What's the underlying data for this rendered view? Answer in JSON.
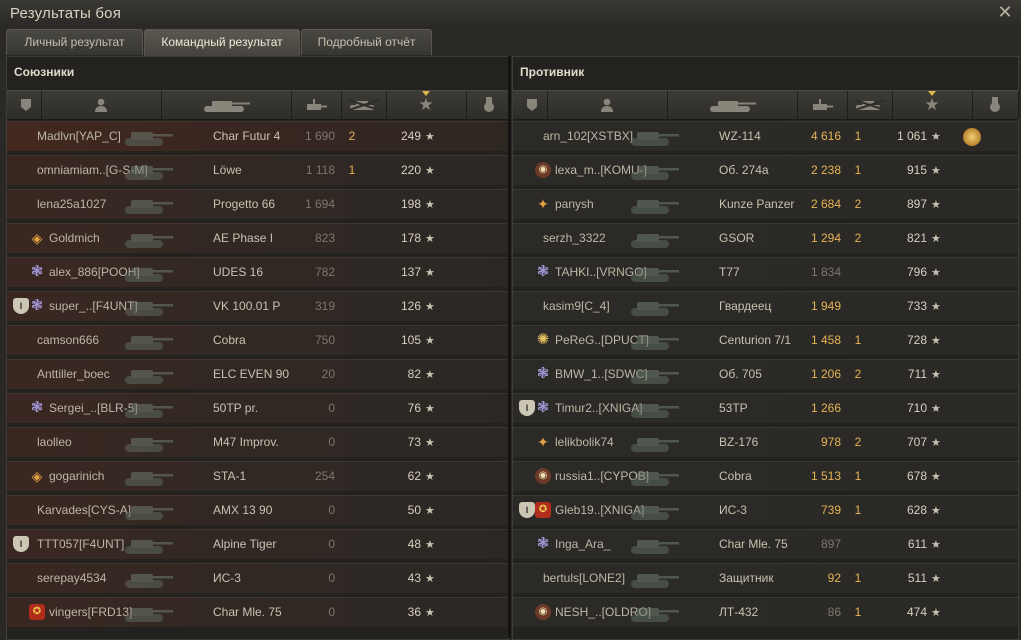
{
  "window": {
    "title": "Результаты боя",
    "close_icon": "close-icon"
  },
  "tabs": [
    {
      "label": "Личный результат",
      "active": false
    },
    {
      "label": "Командный результат",
      "active": true
    },
    {
      "label": "Подробный отчёт",
      "active": false
    }
  ],
  "columns": [
    "squad-icon",
    "player-icon",
    "tank-icon",
    "damage-icon",
    "kills-icon",
    "xp-star-icon",
    "medal-icon"
  ],
  "allies": {
    "title": "Союзники",
    "rows": [
      {
        "name": "Madlvn[YAP_C]",
        "badge": "",
        "tank": "Char Futur 4",
        "damage": "1 690",
        "kills": "2",
        "xp": "249",
        "highlight": true
      },
      {
        "name": "omniamiam..[G-S-M]",
        "badge": "",
        "tank": "Löwe",
        "damage": "1 118",
        "kills": "1",
        "xp": "220"
      },
      {
        "name": "lena25a1027",
        "badge": "",
        "tank": "Progetto 66",
        "damage": "1 694",
        "kills": "",
        "xp": "198"
      },
      {
        "name": "Goldmich",
        "badge": "diamond",
        "tank": "AE Phase I",
        "damage": "823",
        "kills": "",
        "xp": "178"
      },
      {
        "name": "alex_886[POOH]",
        "badge": "gear",
        "tank": "UDES 16",
        "damage": "782",
        "kills": "",
        "xp": "137"
      },
      {
        "name": "super_..[F4UNT]",
        "badge": "gear",
        "squad": "I",
        "tank": "VK 100.01 P",
        "damage": "319",
        "kills": "",
        "xp": "126"
      },
      {
        "name": "camson666",
        "badge": "",
        "tank": "Cobra",
        "damage": "750",
        "kills": "",
        "xp": "105"
      },
      {
        "name": "Anttiller_boec",
        "badge": "",
        "tank": "ELC EVEN 90",
        "damage": "20",
        "kills": "",
        "xp": "82"
      },
      {
        "name": "Sergei_..[BLR-5]",
        "badge": "gear",
        "tank": "50TP pr.",
        "damage": "0",
        "kills": "",
        "xp": "76"
      },
      {
        "name": "laolleo",
        "badge": "",
        "tank": "M47 Improv.",
        "damage": "0",
        "kills": "",
        "xp": "73"
      },
      {
        "name": "gogarinich",
        "badge": "diamond",
        "tank": "STA-1",
        "damage": "254",
        "kills": "",
        "xp": "62"
      },
      {
        "name": "Karvades[CYS-A]",
        "badge": "",
        "tank": "AMX 13 90",
        "damage": "0",
        "kills": "",
        "xp": "50"
      },
      {
        "name": "TTT057[F4UNT]",
        "badge": "",
        "squad": "I",
        "tank": "Alpine Tiger",
        "damage": "0",
        "kills": "",
        "xp": "48"
      },
      {
        "name": "serepay4534",
        "badge": "",
        "tank": "ИС-3",
        "damage": "0",
        "kills": "",
        "xp": "43"
      },
      {
        "name": "vingers[FRD13]",
        "badge": "red",
        "tank": "Char Mle. 75",
        "damage": "0",
        "kills": "",
        "xp": "36"
      }
    ]
  },
  "enemies": {
    "title": "Противник",
    "rows": [
      {
        "name": "arn_102[XSTBX]",
        "badge": "",
        "tank": "WZ-114",
        "damage": "4 616",
        "kills": "1",
        "xp": "1 061",
        "medal": true
      },
      {
        "name": "lexa_m..[KOMU-]",
        "badge": "round",
        "tank": "Об. 274а",
        "damage": "2 238",
        "kills": "1",
        "xp": "915"
      },
      {
        "name": "panysh",
        "badge": "diamond-w",
        "tank": "Kunze Panzer",
        "damage": "2 684",
        "kills": "2",
        "xp": "897"
      },
      {
        "name": "serzh_3322",
        "badge": "",
        "tank": "GSOR",
        "damage": "1 294",
        "kills": "2",
        "xp": "821"
      },
      {
        "name": "TAHKI..[VRNGO]",
        "badge": "gear",
        "tank": "T77",
        "damage": "1 834",
        "kills": "",
        "xp": "796",
        "dead": true
      },
      {
        "name": "kasim9[C_4]",
        "badge": "",
        "tank": "Гвардеец",
        "damage": "1 949",
        "kills": "",
        "xp": "733"
      },
      {
        "name": "PeReG..[DPUCT]",
        "badge": "sun",
        "tank": "Centurion 7/1",
        "damage": "1 458",
        "kills": "1",
        "xp": "728"
      },
      {
        "name": "BMW_1..[SDWC]",
        "badge": "gear",
        "tank": "Об. 705",
        "damage": "1 206",
        "kills": "2",
        "xp": "711"
      },
      {
        "name": "Timur2..[XNIGA]",
        "badge": "gear",
        "squad": "I",
        "tank": "53TP",
        "damage": "1 266",
        "kills": "",
        "xp": "710"
      },
      {
        "name": "lelikbolik74",
        "badge": "diamond-w",
        "tank": "BZ-176",
        "damage": "978",
        "kills": "2",
        "xp": "707"
      },
      {
        "name": "russia1..[CYPOB]",
        "badge": "round",
        "tank": "Cobra",
        "damage": "1 513",
        "kills": "1",
        "xp": "678"
      },
      {
        "name": "Gleb19..[XNIGA]",
        "badge": "red",
        "squad": "I",
        "tank": "ИС-3",
        "damage": "739",
        "kills": "1",
        "xp": "628"
      },
      {
        "name": "Inga_Ara_",
        "badge": "gear",
        "tank": "Char Mle. 75",
        "damage": "897",
        "kills": "",
        "xp": "611",
        "dead": true
      },
      {
        "name": "bertuls[LONE2]",
        "badge": "",
        "tank": "Защитник",
        "damage": "92",
        "kills": "1",
        "xp": "511"
      },
      {
        "name": "NESH_..[OLDRO]",
        "badge": "round",
        "tank": "ЛТ-432",
        "damage": "86",
        "kills": "1",
        "xp": "474",
        "dead": true
      }
    ]
  }
}
